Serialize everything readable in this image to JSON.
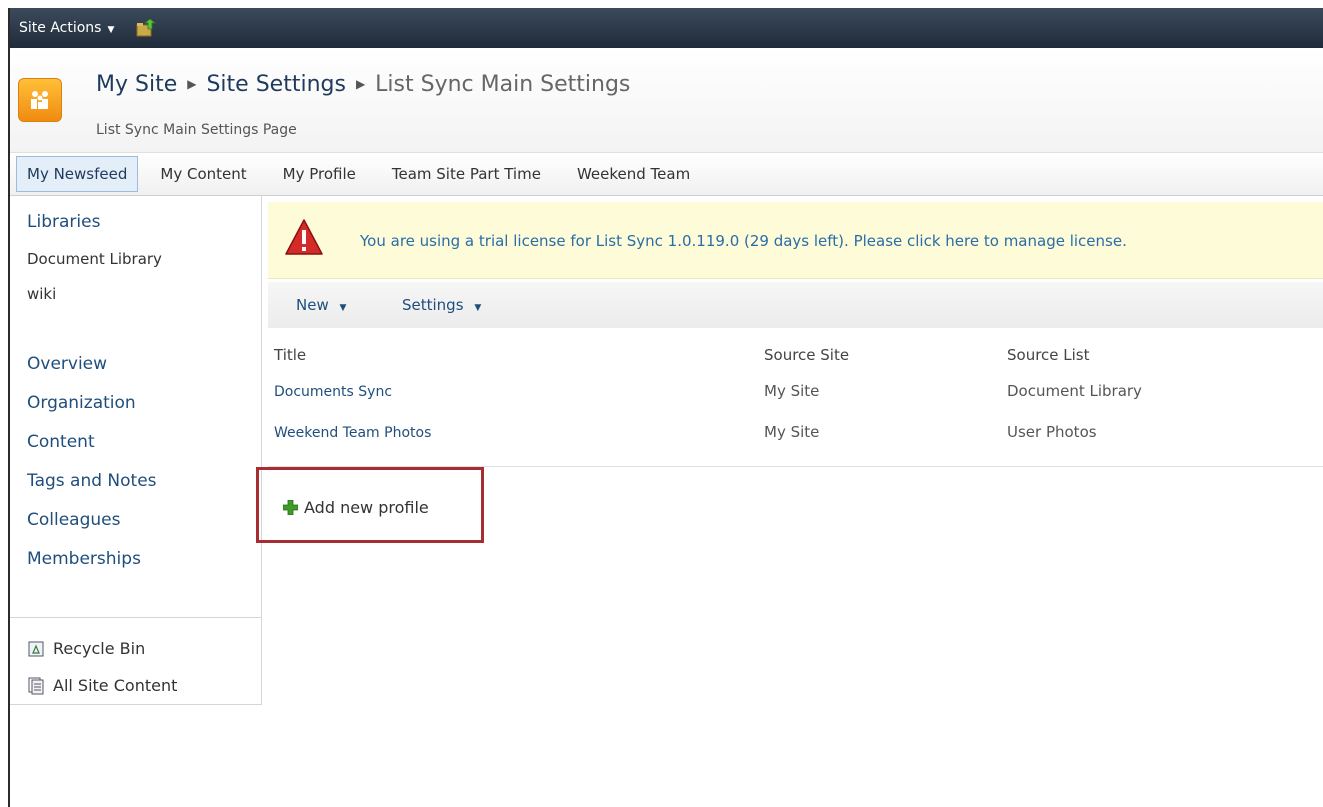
{
  "topbar": {
    "site_actions": "Site Actions"
  },
  "header": {
    "breadcrumb": [
      "My Site",
      "Site Settings",
      "List Sync Main Settings"
    ],
    "subtitle": "List Sync Main Settings Page"
  },
  "tabs": [
    "My Newsfeed",
    "My Content",
    "My Profile",
    "Team Site Part Time",
    "Weekend Team"
  ],
  "quick_launch": {
    "libraries_heading": "Libraries",
    "libraries": [
      "Document Library",
      "wiki"
    ],
    "links": [
      "Overview",
      "Organization",
      "Content",
      "Tags and Notes",
      "Colleagues",
      "Memberships"
    ],
    "recycle_bin": "Recycle Bin",
    "all_site_content": "All Site Content"
  },
  "license_notice": "You are using a trial license for List Sync 1.0.119.0 (29 days left). Please click here to manage license.",
  "toolbar": {
    "new": "New",
    "settings": "Settings"
  },
  "table": {
    "columns": [
      "Title",
      "Source Site",
      "Source List"
    ],
    "rows": [
      {
        "title": "Documents Sync",
        "source_site": "My Site",
        "source_list": "Document Library"
      },
      {
        "title": "Weekend Team Photos",
        "source_site": "My Site",
        "source_list": "User Photos"
      }
    ]
  },
  "add_profile": "Add new profile",
  "colors": {
    "topbar": "#2a3646",
    "highlight_box": "#a82d33",
    "license_bg": "#fdfbd8",
    "link": "#1f4e7c"
  }
}
